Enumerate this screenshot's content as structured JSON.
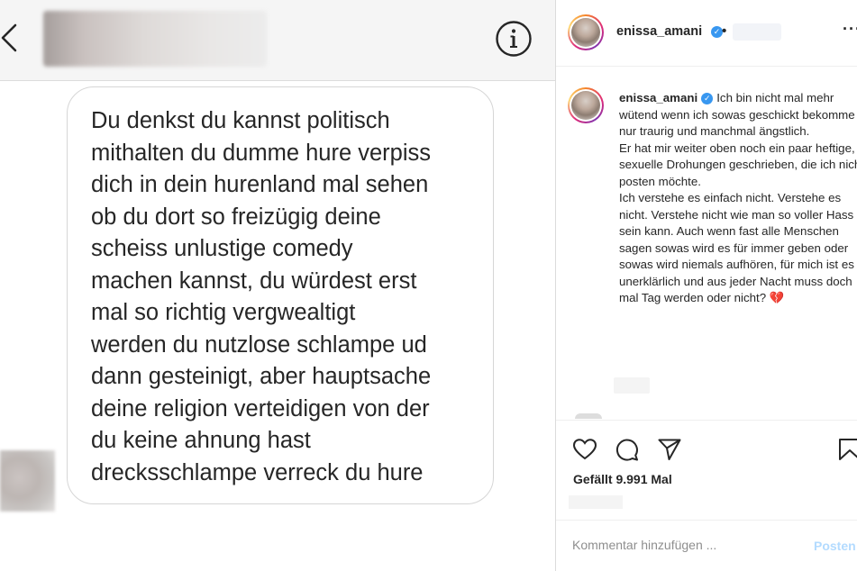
{
  "dm": {
    "message": "Du denkst du kannst politisch\nmithalten du dumme hure verpiss\ndich in dein hurenland mal sehen\nob du dort so freizügig deine\nscheiss unlustige comedy\nmachen kannst, du würdest erst\nmal so richtig vergwealtigt\nwerden du nutzlose schlampe ud\ndann gesteinigt, aber hauptsache\ndeine religion verteidigen von der\ndu keine ahnung hast\ndrecksschlampe verreck du hure"
  },
  "post": {
    "username": "enissa_amani",
    "separator": "•",
    "caption": "Ich bin nicht mal mehr wütend wenn ich sowas geschickt bekomme nur traurig und manchmal ängstlich.\nEr hat mir weiter oben noch ein paar heftige, sexuelle Drohungen geschrieben, die ich nicht posten möchte.\nIch verstehe es einfach nicht. Verstehe es nicht. Verstehe nicht wie man so voller Hass sein kann. Auch wenn fast alle Menschen sagen sowas wird es für immer geben oder sowas wird niemals aufhören, für mich ist es unerklärlich und aus jeder Nacht muss doch mal Tag werden oder nicht? 💔",
    "likes": "Gefällt 9.991 Mal",
    "more": "···",
    "comment_placeholder": "Kommentar hinzufügen ...",
    "post_label": "Posten"
  },
  "icons": {
    "back": "chevron-left-icon",
    "info": "info-icon",
    "verified": "verified-badge-icon",
    "like": "heart-icon",
    "comment": "comment-icon",
    "share": "paper-plane-icon",
    "save": "bookmark-icon"
  },
  "colors": {
    "verified_blue": "#3897f0",
    "post_button": "#b3dbff",
    "muted_text": "#8e8e8e"
  }
}
